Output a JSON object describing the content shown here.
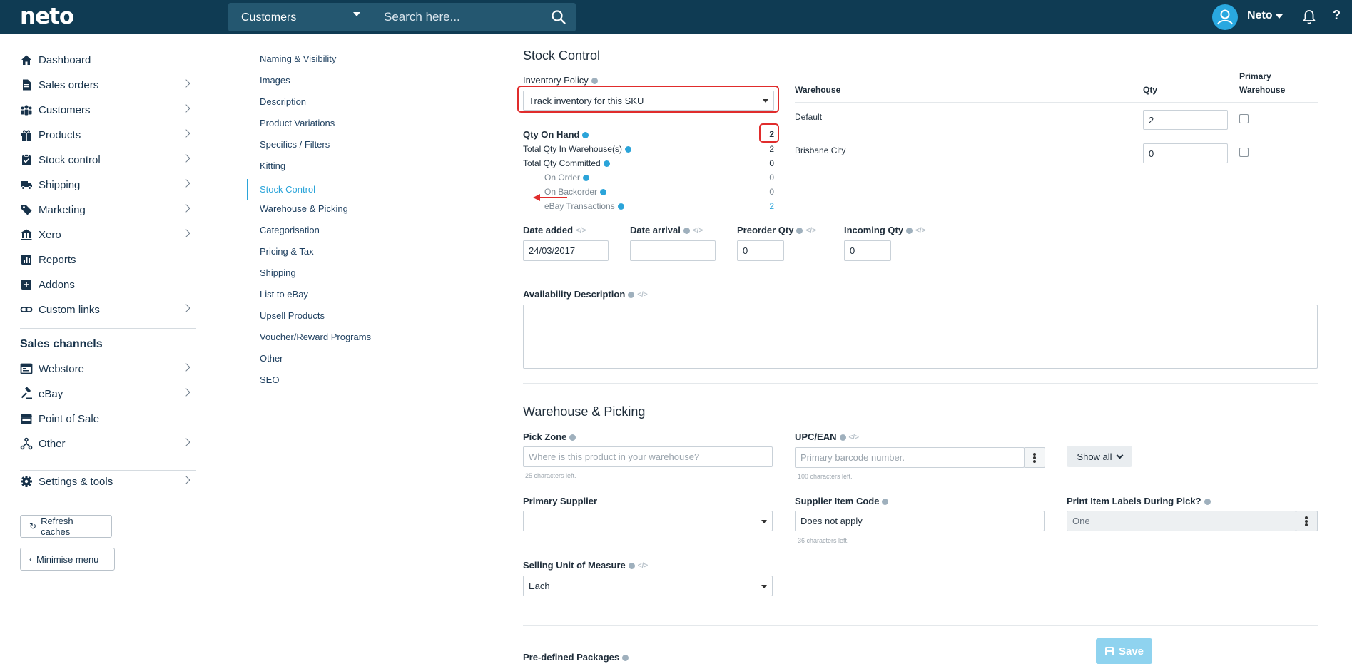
{
  "topbar": {
    "logo": "neto",
    "search_scope": "Customers",
    "search_placeholder": "Search here...",
    "user_name": "Neto",
    "help": "?"
  },
  "sidebar": {
    "items": [
      {
        "label": "Dashboard",
        "icon": "home-icon",
        "chevron": false
      },
      {
        "label": "Sales orders",
        "icon": "document-icon",
        "chevron": true
      },
      {
        "label": "Customers",
        "icon": "people-icon",
        "chevron": true
      },
      {
        "label": "Products",
        "icon": "gift-icon",
        "chevron": true
      },
      {
        "label": "Stock control",
        "icon": "clipboard-icon",
        "chevron": true
      },
      {
        "label": "Shipping",
        "icon": "truck-icon",
        "chevron": true
      },
      {
        "label": "Marketing",
        "icon": "tag-icon",
        "chevron": true
      },
      {
        "label": "Xero",
        "icon": "bank-icon",
        "chevron": true
      },
      {
        "label": "Reports",
        "icon": "chart-icon",
        "chevron": false
      },
      {
        "label": "Addons",
        "icon": "plus-box-icon",
        "chevron": false
      },
      {
        "label": "Custom links",
        "icon": "link-icon",
        "chevron": true
      }
    ],
    "channels_heading": "Sales channels",
    "channels": [
      {
        "label": "Webstore",
        "icon": "browser-icon",
        "chevron": true
      },
      {
        "label": "eBay",
        "icon": "gavel-icon",
        "chevron": true
      },
      {
        "label": "Point of Sale",
        "icon": "store-icon",
        "chevron": false
      },
      {
        "label": "Other",
        "icon": "branch-icon",
        "chevron": true
      }
    ],
    "settings": {
      "label": "Settings & tools",
      "icon": "gear-icon"
    },
    "refresh_label": "Refresh caches",
    "minimise_label": "Minimise menu"
  },
  "section_nav": {
    "items": [
      "Naming & Visibility",
      "Images",
      "Description",
      "Product Variations",
      "Specifics / Filters",
      "Kitting",
      "Stock Control",
      "Warehouse & Picking",
      "Categorisation",
      "Pricing & Tax",
      "Shipping",
      "List to eBay",
      "Upsell Products",
      "Voucher/Reward Programs",
      "Other",
      "SEO"
    ],
    "active_index": 6
  },
  "stock_control": {
    "title": "Stock Control",
    "inventory_policy_label": "Inventory Policy",
    "inventory_policy_value": "Track inventory for this SKU",
    "qty_on_hand_label": "Qty On Hand",
    "qty_on_hand": "2",
    "rows": [
      {
        "label": "Total Qty In Warehouse(s)",
        "value": "2"
      },
      {
        "label": "Total Qty Committed",
        "value": "0"
      }
    ],
    "subrows": [
      {
        "label": "On Order",
        "value": "0"
      },
      {
        "label": "On Backorder",
        "value": "0"
      },
      {
        "label": "eBay Transactions",
        "value": "2"
      }
    ],
    "warehouse_table": {
      "col_warehouse": "Warehouse",
      "col_qty": "Qty",
      "col_primary_1": "Primary",
      "col_primary_2": "Warehouse",
      "rows": [
        {
          "name": "Default",
          "qty": "2"
        },
        {
          "name": "Brisbane City",
          "qty": "0"
        }
      ]
    },
    "date_added_label": "Date added",
    "date_added": "24/03/2017",
    "date_arrival_label": "Date arrival",
    "date_arrival": "",
    "preorder_label": "Preorder Qty",
    "preorder_qty": "0",
    "incoming_label": "Incoming Qty",
    "incoming_qty": "0",
    "availability_label": "Availability Description"
  },
  "warehouse_picking": {
    "title": "Warehouse & Picking",
    "pick_zone_label": "Pick Zone",
    "pick_zone_placeholder": "Where is this product in your warehouse?",
    "pick_zone_hint": "25 characters left.",
    "upc_label": "UPC/EAN",
    "upc_placeholder": "Primary barcode number.",
    "upc_hint": "100 characters left.",
    "show_all": "Show all",
    "primary_supplier_label": "Primary Supplier",
    "primary_supplier_value": "",
    "supplier_code_label": "Supplier Item Code",
    "supplier_code_value": "Does not apply",
    "supplier_code_hint": "36 characters left.",
    "print_labels_label": "Print Item Labels During Pick?",
    "print_labels_value": "One",
    "selling_unit_label": "Selling Unit of Measure",
    "selling_unit_value": "Each"
  },
  "footer": {
    "predefined_label": "Pre-defined Packages",
    "save_label": "Save"
  },
  "colors": {
    "topbar": "#0f3b53",
    "accent": "#2ba4d9",
    "annotation": "#e02c2c"
  }
}
